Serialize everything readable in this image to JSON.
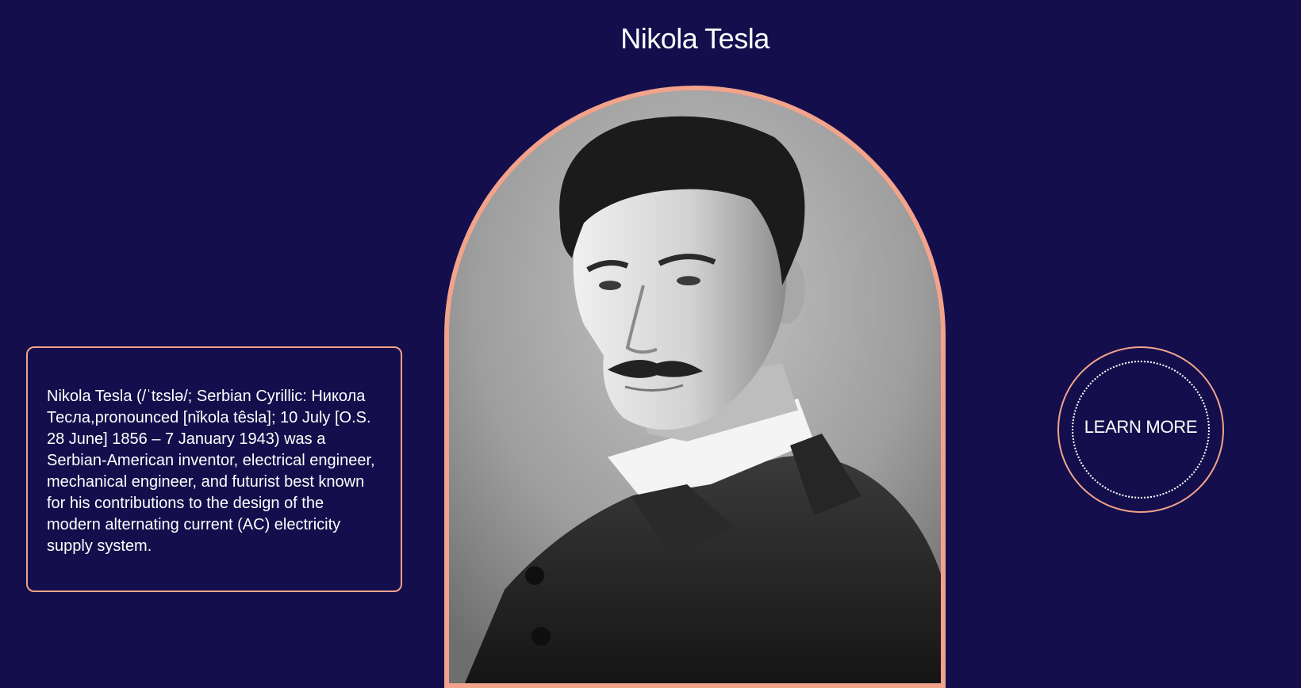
{
  "page": {
    "title": "Nikola Tesla"
  },
  "portrait": {
    "alt": "Nikola Tesla portrait"
  },
  "bio": {
    "text": "Nikola Tesla (/ˈtɛslə/; Serbian Cyrillic: Никола Тесла,pronounced [nǐkola têsla]; 10 July [O.S. 28 June] 1856 – 7 January 1943) was a Serbian-American inventor, electrical engineer, mechanical engineer, and futurist best known for his contributions to the design of the modern alternating current (AC) electricity supply system."
  },
  "cta": {
    "label": "LEARN MORE"
  },
  "colors": {
    "background": "#140e4c",
    "accent": "#f1a38b",
    "text": "#ffffff"
  }
}
